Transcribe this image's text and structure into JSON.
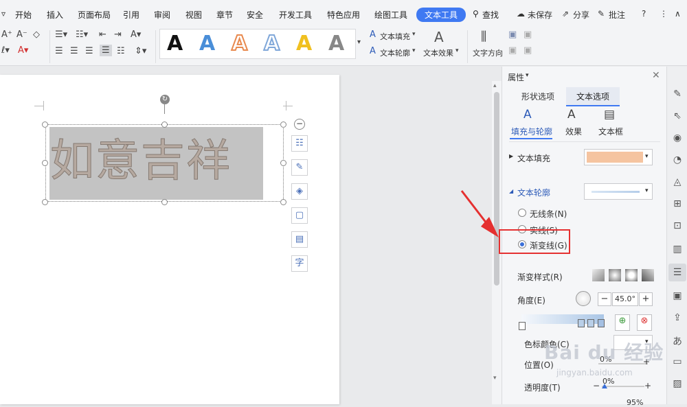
{
  "menu": {
    "items": [
      "开始",
      "插入",
      "页面布局",
      "引用",
      "审阅",
      "视图",
      "章节",
      "安全",
      "开发工具",
      "特色应用",
      "绘图工具"
    ],
    "active": "文本工具",
    "search": "查找",
    "unsaved": "未保存",
    "share": "分享",
    "annotate": "批注"
  },
  "ribbon": {
    "text_fill": "文本填充",
    "text_outline": "文本轮廓",
    "text_effect": "文本效果",
    "text_direction": "文字方向",
    "style_colors": [
      "#111111",
      "#4a8ed8",
      "#e8894e",
      "#7fa7d9",
      "#f0c020",
      "#888888"
    ]
  },
  "document": {
    "wordart": "如意吉祥"
  },
  "panel": {
    "title": "属性",
    "tabs": [
      "形状选项",
      "文本选项"
    ],
    "subtabs": [
      "填充与轮廓",
      "效果",
      "文本框"
    ],
    "text_fill_label": "文本填充",
    "text_fill_color": "#f5c4a0",
    "text_outline_label": "文本轮廓",
    "radio_options": [
      "无线条(N)",
      "实线(S)",
      "渐变线(G)"
    ],
    "selected_radio": "渐变线(G)",
    "gradient_style_label": "渐变样式(R)",
    "angle_label": "角度(E)",
    "angle_value": "45.0°",
    "stop_color_label": "色标颜色(C)",
    "position_label": "位置(O)",
    "position_value": "0%",
    "transparency_label": "透明度(T)",
    "transparency_value": "0%",
    "brightness_value": "95%"
  },
  "watermark": {
    "brand": "Bai du 经验",
    "url": "jingyan.baidu.com"
  }
}
